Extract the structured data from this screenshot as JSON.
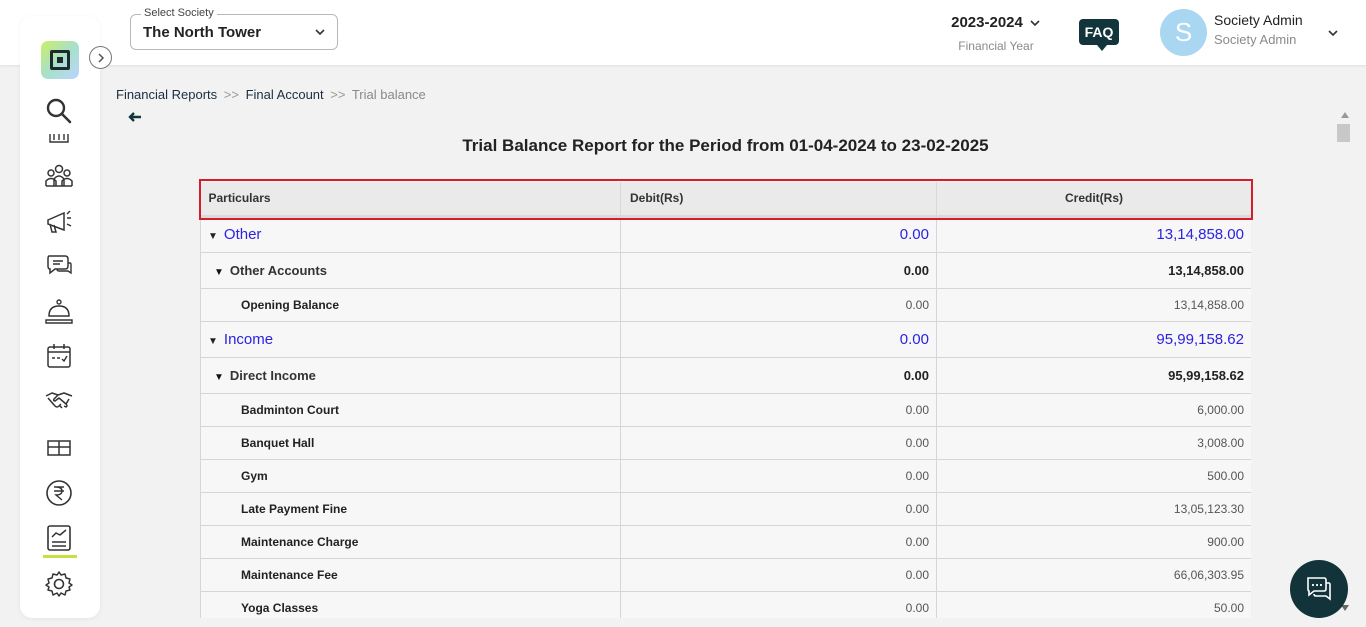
{
  "header": {
    "society_label": "Select Society",
    "society_value": "The North Tower",
    "financial_year": "2023-2024",
    "financial_year_caption": "Financial Year",
    "faq_label": "FAQ",
    "avatar_letter": "S",
    "user_name": "Society Admin",
    "user_role": "Society Admin"
  },
  "breadcrumb": {
    "items": [
      "Financial Reports",
      "Final Account"
    ],
    "separator": ">>",
    "current": "Trial balance"
  },
  "report": {
    "title": "Trial Balance Report for the Period from 01-04-2024 to 23-02-2025",
    "columns": [
      "Particulars",
      "Debit(Rs)",
      "Credit(Rs)"
    ],
    "rows": [
      {
        "level": 1,
        "name": "Other",
        "debit": "0.00",
        "credit": "13,14,858.00"
      },
      {
        "level": 2,
        "name": "Other Accounts",
        "debit": "0.00",
        "credit": "13,14,858.00"
      },
      {
        "level": 3,
        "name": "Opening Balance",
        "debit": "0.00",
        "credit": "13,14,858.00"
      },
      {
        "level": 1,
        "name": "Income",
        "debit": "0.00",
        "credit": "95,99,158.62"
      },
      {
        "level": 2,
        "name": "Direct Income",
        "debit": "0.00",
        "credit": "95,99,158.62"
      },
      {
        "level": 3,
        "name": "Badminton Court",
        "debit": "0.00",
        "credit": "6,000.00"
      },
      {
        "level": 3,
        "name": "Banquet Hall",
        "debit": "0.00",
        "credit": "3,008.00"
      },
      {
        "level": 3,
        "name": "Gym",
        "debit": "0.00",
        "credit": "500.00"
      },
      {
        "level": 3,
        "name": "Late Payment Fine",
        "debit": "0.00",
        "credit": "13,05,123.30"
      },
      {
        "level": 3,
        "name": "Maintenance Charge",
        "debit": "0.00",
        "credit": "900.00"
      },
      {
        "level": 3,
        "name": "Maintenance Fee",
        "debit": "0.00",
        "credit": "66,06,303.95"
      },
      {
        "level": 3,
        "name": "Yoga Classes",
        "debit": "0.00",
        "credit": "50.00"
      }
    ]
  },
  "colors": {
    "highlight": "#d41f2a",
    "group_text": "#2d22e0",
    "dark_accent": "#13333a"
  },
  "sidebar": {
    "icons": [
      "search-icon",
      "building-icon",
      "members-icon",
      "announcement-icon",
      "chat-bubbles-icon",
      "service-bell-icon",
      "calendar-icon",
      "handshake-icon",
      "parcel-icon",
      "rupee-icon",
      "reports-icon",
      "settings-icon"
    ],
    "active": "reports-icon"
  }
}
